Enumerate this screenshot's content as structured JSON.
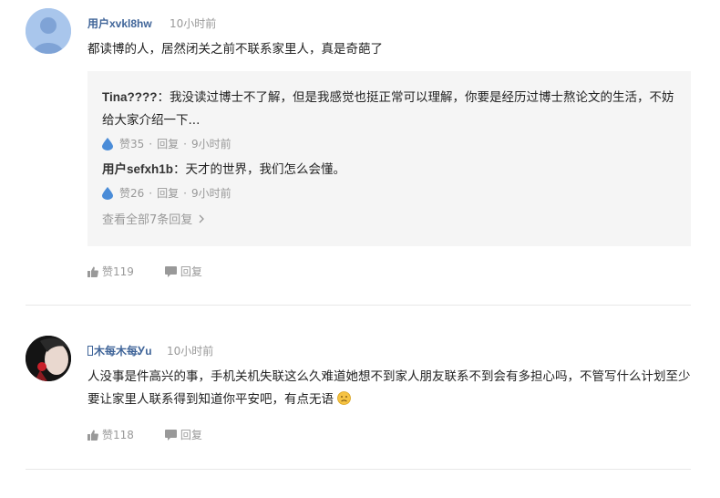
{
  "comments": [
    {
      "username": "用户xvkl8hw",
      "time": "10小时前",
      "text": "都读博的人，居然闭关之前不联系家里人，真是奇葩了",
      "replies": [
        {
          "author": "Tina????",
          "text": "：我没读过博士不了解，但是我感觉也挺正常可以理解，你要是经历过博士熬论文的生活，不妨给大家介绍一下...",
          "likes": "赞35",
          "reply_label": "回复",
          "time": "9小时前"
        },
        {
          "author": "用户sefxh1b",
          "text": "：天才的世界，我们怎么会懂。",
          "likes": "赞26",
          "reply_label": "回复",
          "time": "9小时前"
        }
      ],
      "view_all": "查看全部7条回复",
      "likes": "赞119",
      "reply_label": "回复"
    },
    {
      "username": "木每木每Ꭹu",
      "time": "10小时前",
      "text": "人没事是件高兴的事，手机关机失联这么久难道她想不到家人朋友联系不到会有多担心吗，不管写什么计划至少要让家里人联系得到知道你平安吧，有点无语",
      "likes": "赞118",
      "reply_label": "回复"
    }
  ],
  "colors": {
    "username": "#406599",
    "meta": "#999999",
    "reply_bg": "#f5f5f5",
    "drop_icon": "#4a8cd8"
  },
  "icons": {
    "like": "thumbs-up-icon",
    "reply": "comment-bubble-icon",
    "reply_like": "water-drop-icon",
    "chevron": "chevron-right-icon",
    "emoji": "sad-face-emoji"
  }
}
